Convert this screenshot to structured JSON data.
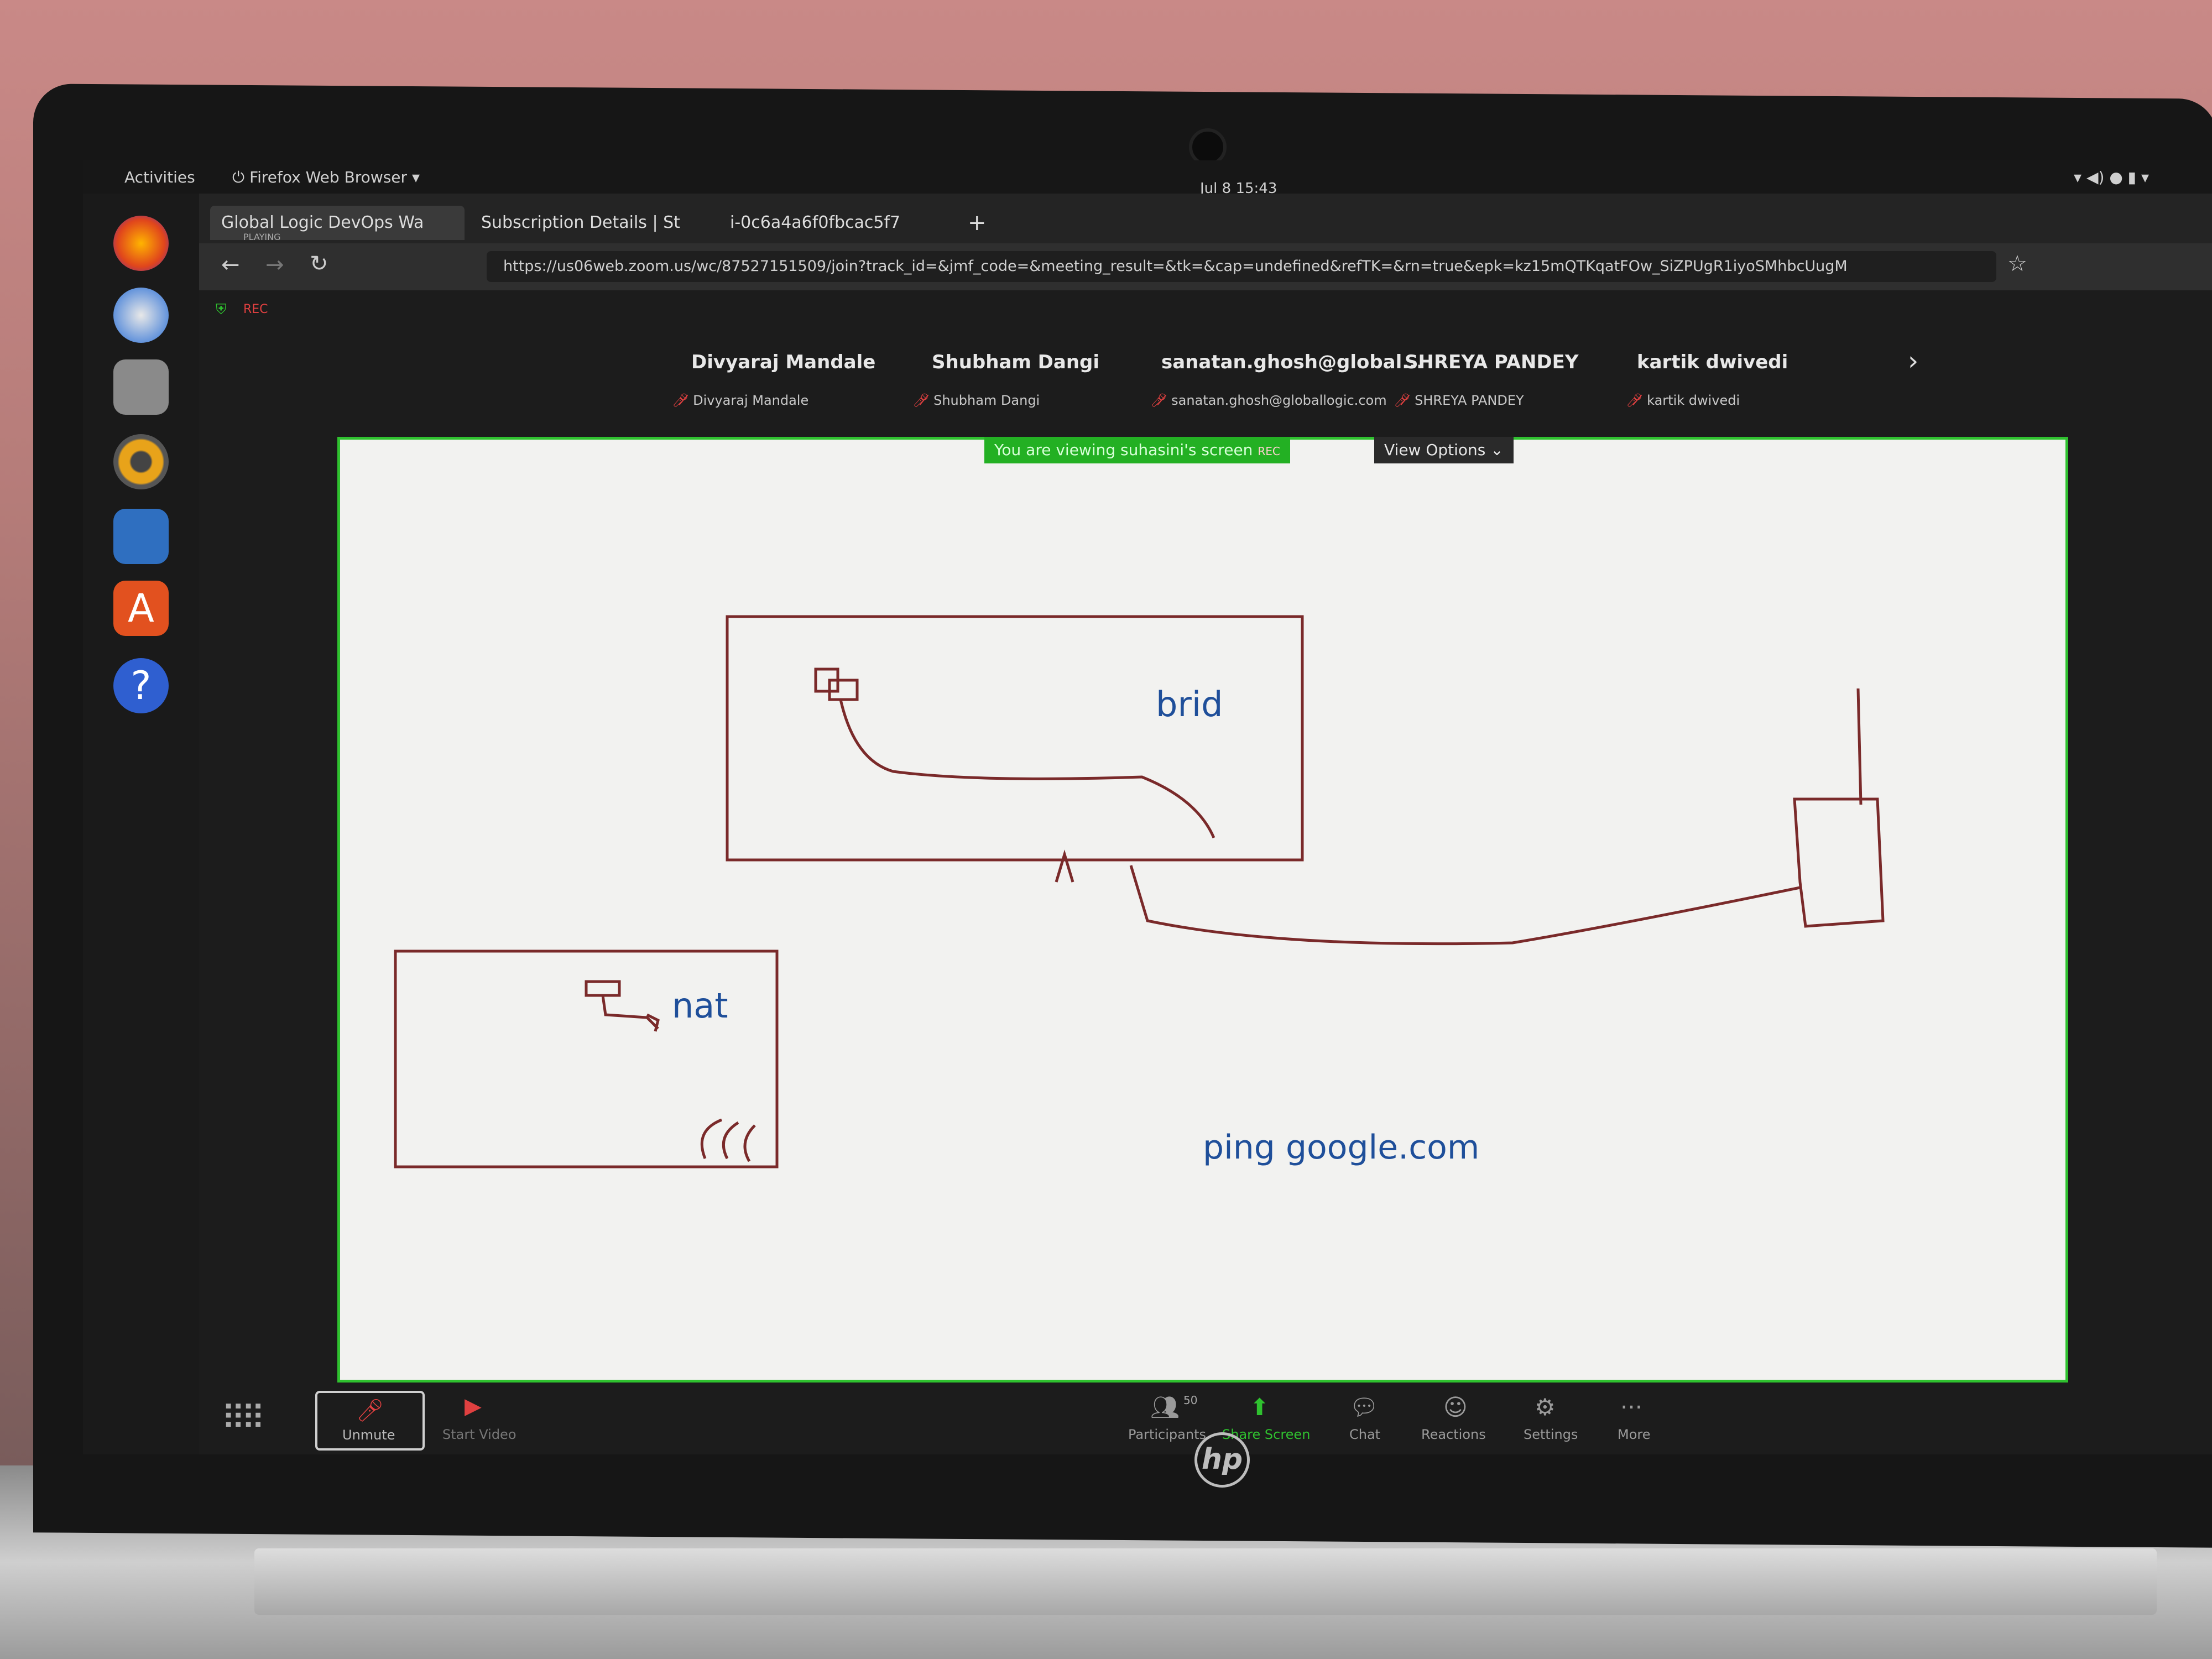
{
  "topbar": {
    "activities": "Activities",
    "app_menu": "Firefox Web Browser",
    "clock": "Jul 8  15:43"
  },
  "browser": {
    "tabs": [
      {
        "label": "Global Logic DevOps Wa",
        "sub": "PLAYING"
      },
      {
        "label": "Subscription Details | St"
      },
      {
        "label": "i-0c6a4a6f0fbcac5f7"
      }
    ],
    "url": "https://us06web.zoom.us/wc/87527151509/join?track_id=&jmf_code=&meeting_result=&tk=&cap=undefined&refTK=&rn=true&epk=kz15mQTKqatFOw_SiZPUgR1iyoSMhbcUugM",
    "rec": "REC"
  },
  "participants": [
    {
      "name": "Divyaraj Mandale",
      "label": "Divyaraj Mandale"
    },
    {
      "name": "Shubham Dangi",
      "label": "Shubham Dangi"
    },
    {
      "name": "sanatan.ghosh@global...",
      "label": "sanatan.ghosh@globallogic.com"
    },
    {
      "name": "SHREYA PANDEY",
      "label": "SHREYA PANDEY"
    },
    {
      "name": "kartik dwivedi",
      "label": "kartik dwivedi"
    }
  ],
  "share": {
    "banner": "You are viewing suhasini's screen",
    "rec": "REC",
    "view_options": "View Options",
    "whiteboard": {
      "label_brid": "brid",
      "label_nat": "nat",
      "label_ping": "ping google.com"
    }
  },
  "toolbar": {
    "unmute": "Unmute",
    "start_video": "Start Video",
    "participants": "Participants",
    "participants_count": "50",
    "share_screen": "Share Screen",
    "chat": "Chat",
    "reactions": "Reactions",
    "settings": "Settings",
    "more": "More"
  },
  "colors": {
    "share_border": "#2fc12f",
    "ink": "#7a2a2a",
    "text_ink": "#1f4f9a"
  }
}
